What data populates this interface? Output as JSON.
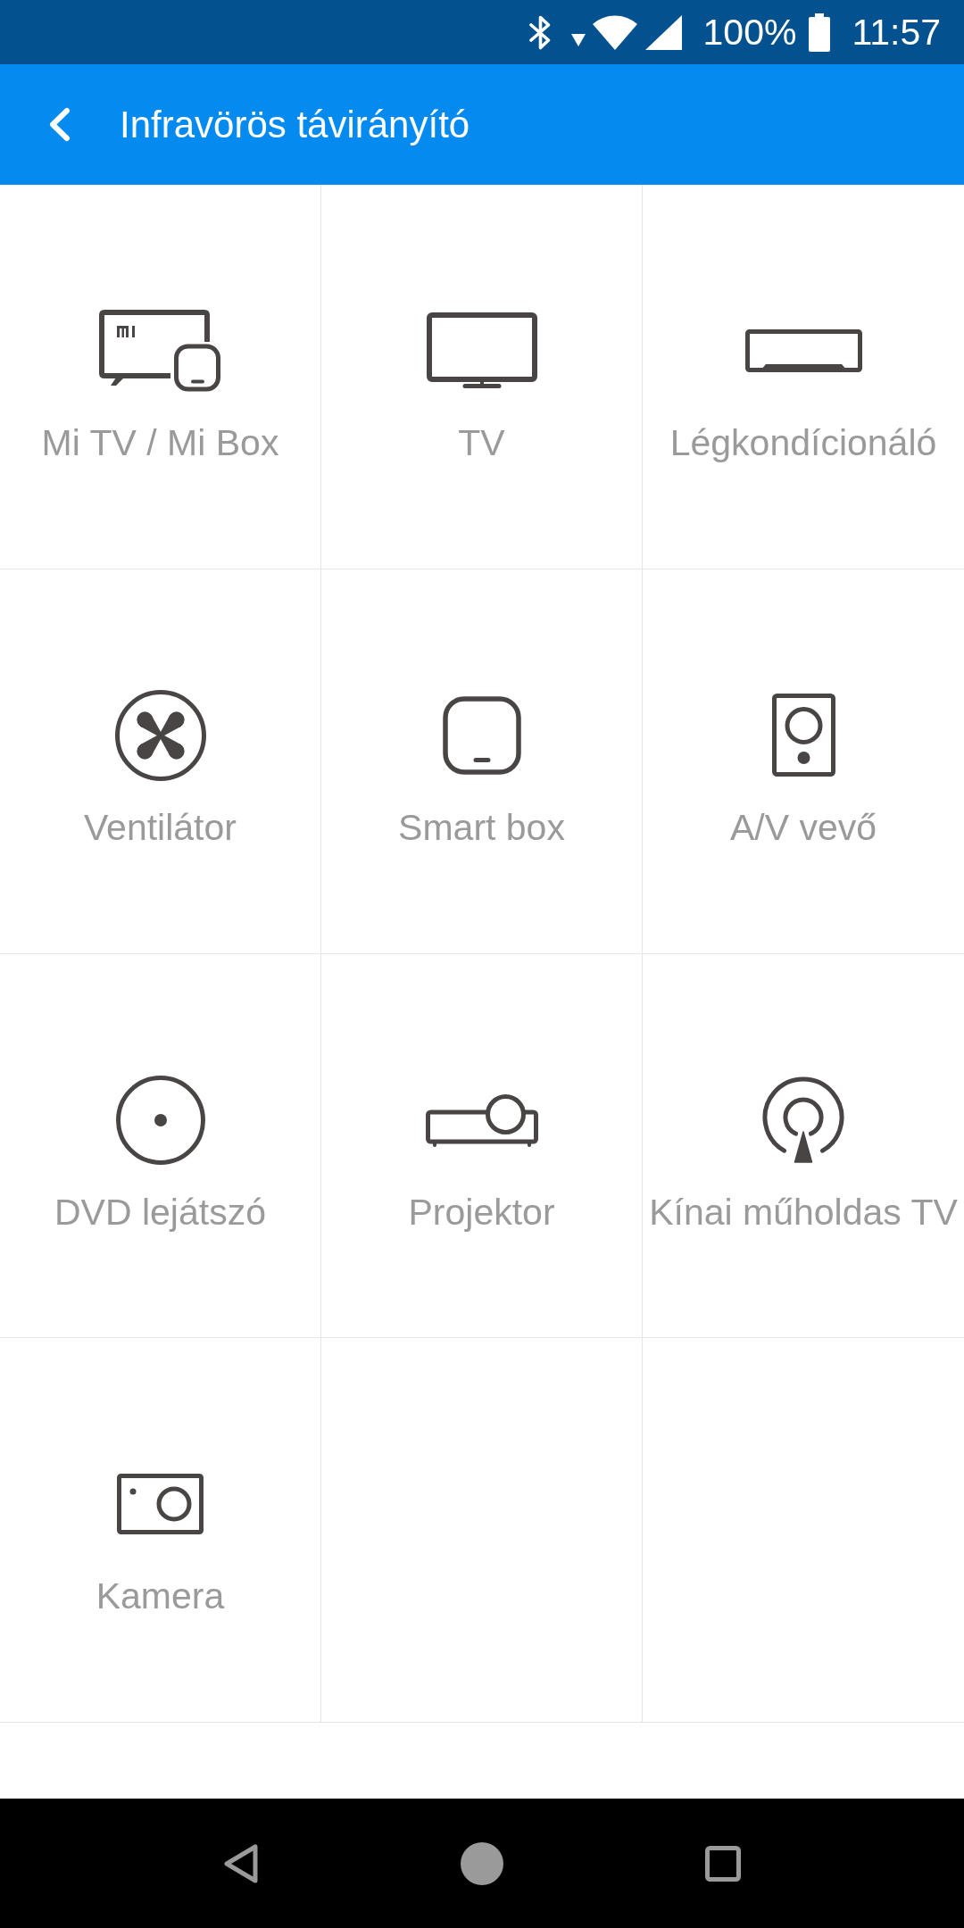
{
  "status_bar": {
    "battery_percent": "100%",
    "time": "11:57"
  },
  "app_bar": {
    "title": "Infravörös távirányító"
  },
  "devices": [
    {
      "label": "Mi TV / Mi Box",
      "kind": "mitv"
    },
    {
      "label": "TV",
      "kind": "tv"
    },
    {
      "label": "Légkondícionáló",
      "kind": "aircon"
    },
    {
      "label": "Ventilátor",
      "kind": "fan"
    },
    {
      "label": "Smart box",
      "kind": "box"
    },
    {
      "label": "A/V vevő",
      "kind": "speaker"
    },
    {
      "label": "DVD lejátszó",
      "kind": "disc"
    },
    {
      "label": "Projektor",
      "kind": "projector"
    },
    {
      "label": "Kínai műholdas TV",
      "kind": "satellite"
    },
    {
      "label": "Kamera",
      "kind": "camera"
    }
  ]
}
